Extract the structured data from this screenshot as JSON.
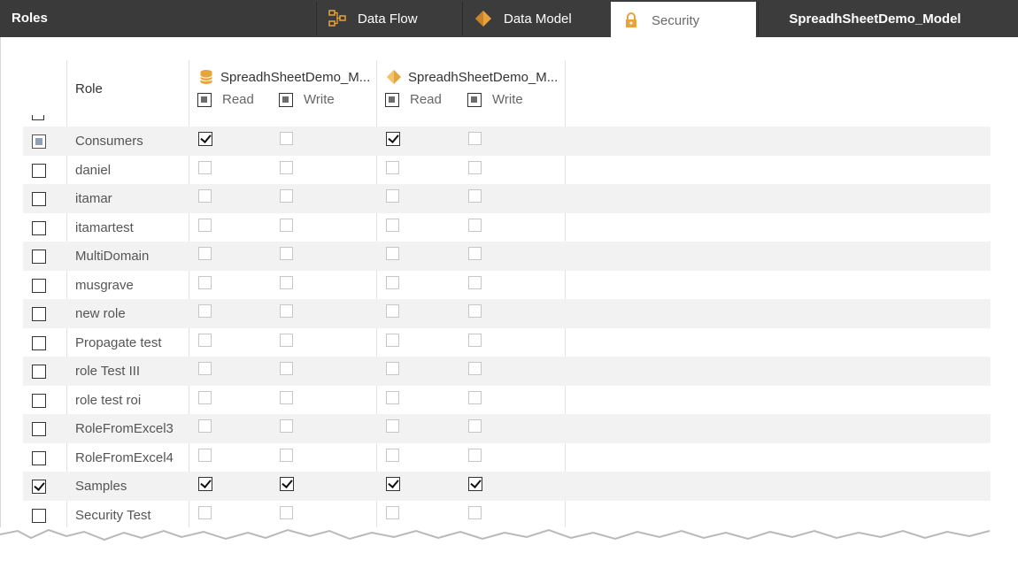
{
  "header": {
    "title": "Roles"
  },
  "tabs": [
    {
      "label": "Data Flow",
      "icon": "data-flow-icon"
    },
    {
      "label": "Data Model",
      "icon": "data-model-icon"
    },
    {
      "label": "Security",
      "icon": "lock-icon",
      "active": true
    },
    {
      "label": "SpreadhSheetDemo_Model"
    }
  ],
  "table": {
    "role_header": "Role",
    "sources": [
      {
        "name": "SpreadhSheetDemo_M...",
        "icon": "database-icon",
        "read_label": "Read",
        "write_label": "Write"
      },
      {
        "name": "SpreadhSheetDemo_M...",
        "icon": "model-icon",
        "read_label": "Read",
        "write_label": "Write"
      }
    ],
    "rows": [
      {
        "name": "Consumers",
        "selected": "indeterminate",
        "perms": [
          true,
          false,
          true,
          false
        ]
      },
      {
        "name": "daniel",
        "selected": false,
        "perms": [
          false,
          false,
          false,
          false
        ]
      },
      {
        "name": "itamar",
        "selected": false,
        "perms": [
          false,
          false,
          false,
          false
        ]
      },
      {
        "name": "itamartest",
        "selected": false,
        "perms": [
          false,
          false,
          false,
          false
        ]
      },
      {
        "name": "MultiDomain",
        "selected": false,
        "perms": [
          false,
          false,
          false,
          false
        ]
      },
      {
        "name": "musgrave",
        "selected": false,
        "perms": [
          false,
          false,
          false,
          false
        ]
      },
      {
        "name": "new role",
        "selected": false,
        "perms": [
          false,
          false,
          false,
          false
        ]
      },
      {
        "name": "Propagate test",
        "selected": false,
        "perms": [
          false,
          false,
          false,
          false
        ]
      },
      {
        "name": "role Test III",
        "selected": false,
        "perms": [
          false,
          false,
          false,
          false
        ]
      },
      {
        "name": "role test roi",
        "selected": false,
        "perms": [
          false,
          false,
          false,
          false
        ]
      },
      {
        "name": "RoleFromExcel3",
        "selected": false,
        "perms": [
          false,
          false,
          false,
          false
        ]
      },
      {
        "name": "RoleFromExcel4",
        "selected": false,
        "perms": [
          false,
          false,
          false,
          false
        ]
      },
      {
        "name": "Samples",
        "selected": true,
        "perms": [
          true,
          true,
          true,
          true
        ]
      },
      {
        "name": "Security Test",
        "selected": false,
        "perms": [
          false,
          false,
          false,
          false
        ]
      }
    ]
  },
  "colors": {
    "topbar": "#3c3c3c",
    "accent_orange": "#e8a33c",
    "row_alt": "#f2f2f2"
  }
}
